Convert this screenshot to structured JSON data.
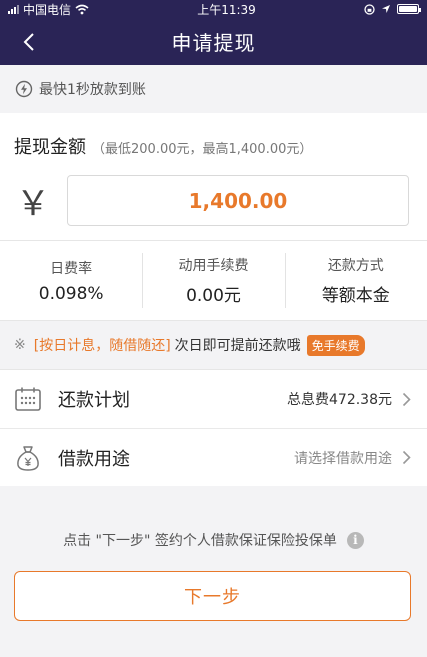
{
  "status_bar": {
    "carrier": "中国电信",
    "time": "上午11:39"
  },
  "nav": {
    "title": "申请提现"
  },
  "notice": {
    "text": "最快1秒放款到账"
  },
  "amount": {
    "title": "提现金额",
    "range": "（最低200.00元，最高1,400.00元）",
    "currency_symbol": "￥",
    "value": "1,400.00"
  },
  "fees": [
    {
      "label": "日费率",
      "value": "0.098%"
    },
    {
      "label": "动用手续费",
      "value": "0.00元"
    },
    {
      "label": "还款方式",
      "value": "等额本金"
    }
  ],
  "promo": {
    "mark": "※",
    "highlight": "[按日计息，随借随还]",
    "text": "次日即可提前还款哦",
    "tag": "免手续费"
  },
  "menu": {
    "plan": {
      "label": "还款计划",
      "value": "总息费472.38元"
    },
    "purpose": {
      "label": "借款用途",
      "value": "请选择借款用途"
    }
  },
  "agreement": {
    "text": "点击 \"下一步\" 签约个人借款保证保险投保单",
    "icon": "i"
  },
  "next_button": {
    "label": "下一步"
  },
  "colors": {
    "nav_bg": "#2a2456",
    "accent": "#e8792b"
  },
  "icons": [
    "back-chevron-icon",
    "wifi-icon",
    "lock-rotation-icon",
    "location-arrow-icon",
    "battery-icon",
    "lightning-icon",
    "calendar-icon",
    "money-bag-icon",
    "chevron-right-icon",
    "info-icon"
  ]
}
